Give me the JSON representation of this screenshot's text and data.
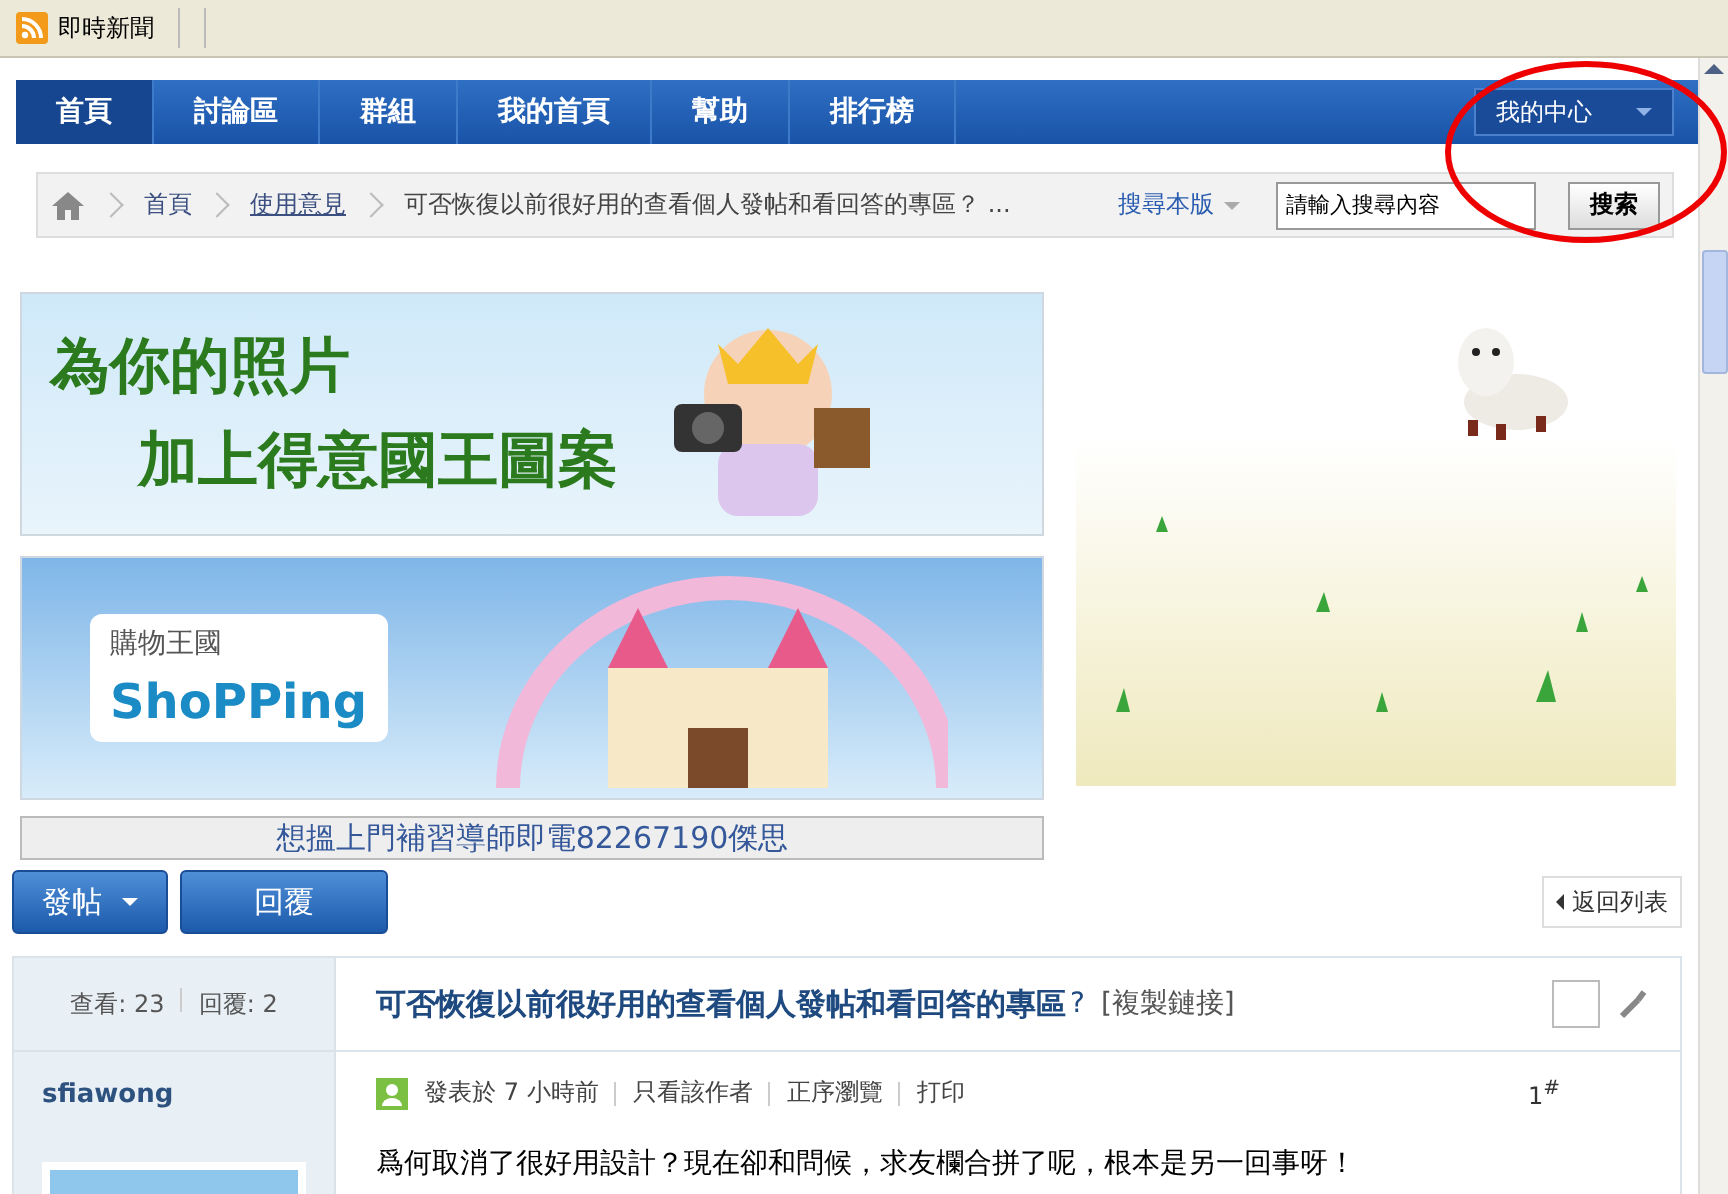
{
  "toolbar": {
    "feed": "即時新聞"
  },
  "nav": {
    "tabs": [
      {
        "label": "首頁",
        "selected": true
      },
      {
        "label": "討論區",
        "selected": false
      },
      {
        "label": "群組",
        "selected": false
      },
      {
        "label": "我的首頁",
        "selected": false
      },
      {
        "label": "幫助",
        "selected": false
      },
      {
        "label": "排行榜",
        "selected": false
      }
    ],
    "user_menu": "我的中心"
  },
  "breadcrumb": {
    "items": [
      "首頁",
      "使用意見",
      "可否恢復以前很好用的查看個人發帖和看回答的專區？ ..."
    ],
    "search_scope": "搜尋本版",
    "search": {
      "value": "請輸入搜尋內容"
    },
    "search_button": "搜索"
  },
  "banners": [
    {
      "lines": [
        "為你的照片",
        "加上得意國王圖案"
      ]
    },
    {
      "lines": [
        "購物王國",
        "ShoPPing"
      ]
    }
  ],
  "ad_link": "想搵上門補習導師即電82267190傑思",
  "actions": {
    "post": "發帖",
    "reply": "回覆",
    "back": "返回列表"
  },
  "thread": {
    "stats": [
      {
        "label": "查看:",
        "value": "23"
      },
      {
        "label": "回覆:",
        "value": "2"
      }
    ],
    "title": "可否恢復以前很好用的查看個人發帖和看回答的專區",
    "title_mark": "?",
    "copy_link": "[複製鏈接]",
    "checked": false
  },
  "post": {
    "author": "sfiawong",
    "posted": "發表於 7 小時前",
    "links": [
      "只看該作者",
      "正序瀏覽",
      "打印"
    ],
    "floor": "1$^{#}$",
    "body": "爲何取消了很好用設計？現在卻和問候，求友欄合拼了呢，根本是另一回事呀！"
  }
}
